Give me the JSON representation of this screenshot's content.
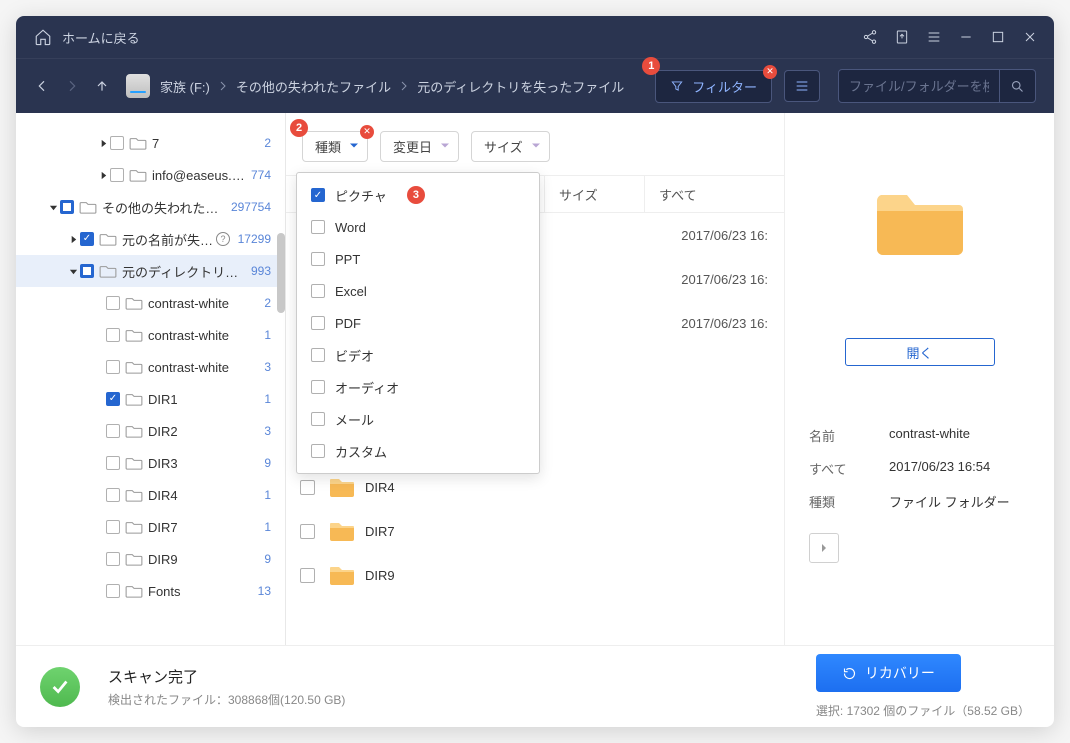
{
  "titlebar": {
    "home": "ホームに戻る"
  },
  "nav": {
    "disk": "家族 (F:)",
    "crumb1": "その他の失われたファイル",
    "crumb2": "元のディレクトリを失ったファイル",
    "filter": "フィルター",
    "search_placeholder": "ファイル/フォルダーを検索"
  },
  "badges": {
    "b1": "1",
    "b2": "2",
    "b3": "3"
  },
  "chips": {
    "type": "種類",
    "date": "変更日",
    "size": "サイズ"
  },
  "dropdown": [
    "ピクチャ",
    "Word",
    "PPT",
    "Excel",
    "PDF",
    "ビデオ",
    "オーディオ",
    "メール",
    "カスタム"
  ],
  "table": {
    "col_size": "サイズ",
    "col_date": "すべて",
    "rows_hidden": [
      {
        "date": "2017/06/23 16:"
      },
      {
        "date": "2017/06/23 16:"
      },
      {
        "date": "2017/06/23 16:"
      }
    ],
    "rows": [
      {
        "name": "DIR4"
      },
      {
        "name": "DIR7"
      },
      {
        "name": "DIR9"
      }
    ]
  },
  "tree": [
    {
      "indent": 80,
      "caret": "right",
      "check": "",
      "label": "7",
      "count": "2"
    },
    {
      "indent": 80,
      "caret": "right",
      "check": "",
      "label": "info@easeus.…",
      "count": "774"
    },
    {
      "indent": 30,
      "caret": "down",
      "check": "mixed",
      "label": "その他の失われたフ…",
      "count": "297754"
    },
    {
      "indent": 50,
      "caret": "right",
      "check": "checked",
      "label": "元の名前が失…",
      "help": true,
      "count": "17299"
    },
    {
      "indent": 50,
      "caret": "down",
      "check": "mixed",
      "label": "元のディレクトリを失っ…",
      "count": "993",
      "selected": true
    },
    {
      "indent": 76,
      "caret": "",
      "check": "",
      "label": "contrast-white",
      "count": "2"
    },
    {
      "indent": 76,
      "caret": "",
      "check": "",
      "label": "contrast-white",
      "count": "1"
    },
    {
      "indent": 76,
      "caret": "",
      "check": "",
      "label": "contrast-white",
      "count": "3"
    },
    {
      "indent": 76,
      "caret": "",
      "check": "checked",
      "label": "DIR1",
      "count": "1"
    },
    {
      "indent": 76,
      "caret": "",
      "check": "",
      "label": "DIR2",
      "count": "3"
    },
    {
      "indent": 76,
      "caret": "",
      "check": "",
      "label": "DIR3",
      "count": "9"
    },
    {
      "indent": 76,
      "caret": "",
      "check": "",
      "label": "DIR4",
      "count": "1"
    },
    {
      "indent": 76,
      "caret": "",
      "check": "",
      "label": "DIR7",
      "count": "1"
    },
    {
      "indent": 76,
      "caret": "",
      "check": "",
      "label": "DIR9",
      "count": "9"
    },
    {
      "indent": 76,
      "caret": "",
      "check": "",
      "label": "Fonts",
      "count": "13"
    }
  ],
  "preview": {
    "open": "開く",
    "k_name": "名前",
    "v_name": "contrast-white",
    "k_all": "すべて",
    "v_all": "2017/06/23 16:54",
    "k_type": "種類",
    "v_type": "ファイル フォルダー"
  },
  "footer": {
    "title": "スキャン完了",
    "sub": "検出されたファイル：308868個(120.50 GB)",
    "recover": "リカバリー",
    "selection": "選択: 17302 個のファイル（58.52 GB）"
  }
}
